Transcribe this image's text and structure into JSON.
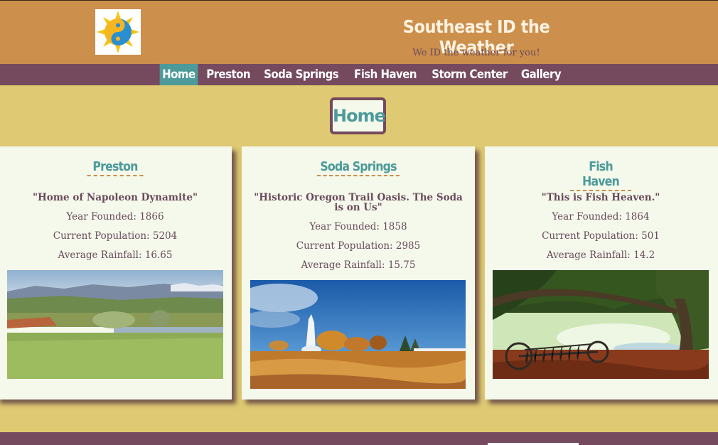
{
  "header": {
    "title": "Southeast ID the Weather",
    "tagline": "We ID the weather for you!",
    "logo_icon": "sun-yin-yang-icon"
  },
  "nav": {
    "items": [
      {
        "label": "Home",
        "active": true
      },
      {
        "label": "Preston"
      },
      {
        "label": "Soda Springs"
      },
      {
        "label": "Fish Haven"
      },
      {
        "label": "Storm Center"
      },
      {
        "label": "Gallery"
      }
    ]
  },
  "page": {
    "heading": "Home"
  },
  "towns": [
    {
      "name": "Preston",
      "motto": "\"Home of Napoleon Dynamite\"",
      "founded": "Year Founded: 1866",
      "population": "Current Population: 5204",
      "rainfall": "Average Rainfall: 16.65",
      "image": "green meadow with mountains"
    },
    {
      "name": "Soda Springs",
      "motto": "\"Historic Oregon Trail Oasis. The Soda is on Us\"",
      "founded": "Year Founded: 1858",
      "population": "Current Population: 2985",
      "rainfall": "Average Rainfall: 15.75",
      "image": "geyser erupting under blue sky"
    },
    {
      "name": "Fish Haven",
      "motto": "\"This is Fish Heaven.\"",
      "founded": "Year Founded: 1864",
      "population": "Current Population: 501",
      "rainfall": "Average Rainfall: 14.2",
      "image": "old farm rake under a large tree"
    }
  ],
  "colors": {
    "header_bg": "#cc8f4c",
    "nav_bg": "#754a5e",
    "page_bg": "#dfc972",
    "accent_teal": "#4d9a9a",
    "card_bg": "#f4f9eb"
  }
}
